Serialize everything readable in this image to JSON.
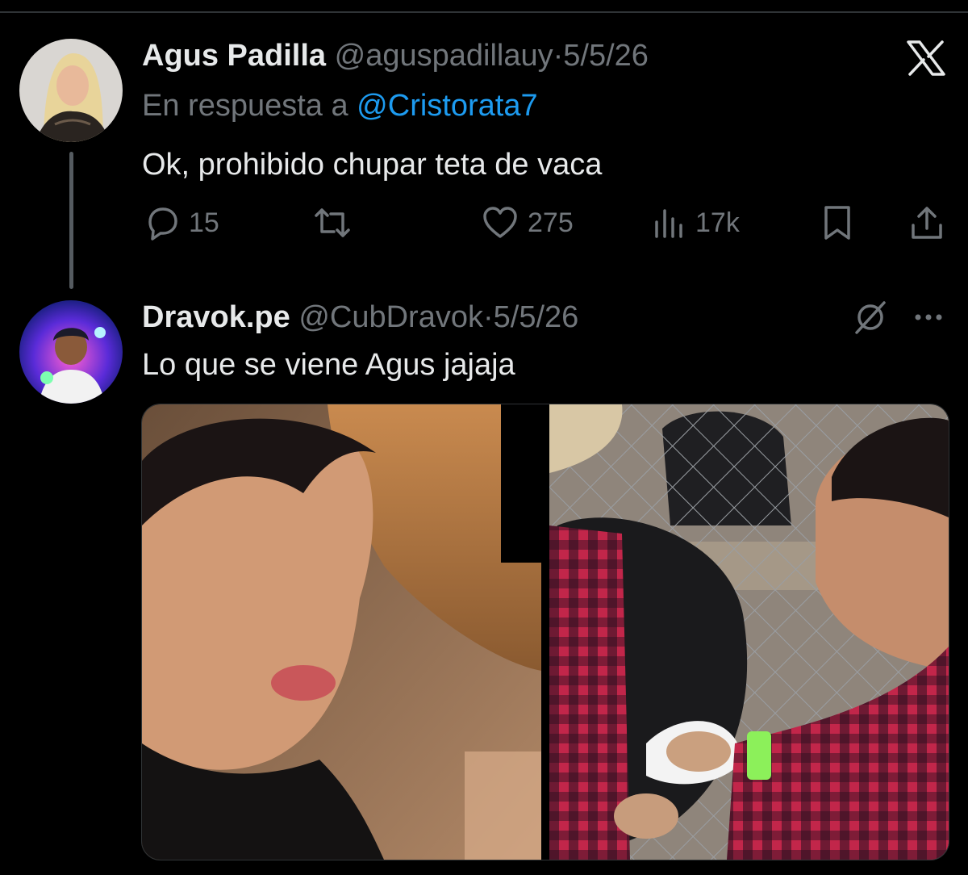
{
  "tweet1": {
    "author_name": "Agus Padilla",
    "handle": "@aguspadillauy",
    "separator": "·",
    "date": "5/5/26",
    "reply_prefix": "En respuesta a",
    "reply_mention": "@Cristorata7",
    "text": "Ok, prohibido chupar teta de vaca",
    "stats": {
      "replies": "15",
      "likes": "275",
      "views": "17k"
    },
    "icons": [
      "reply-icon",
      "retweet-icon",
      "like-icon",
      "views-icon",
      "bookmark-icon",
      "share-icon"
    ]
  },
  "tweet2": {
    "author_name": "Dravok.pe",
    "handle": "@CubDravok",
    "separator": "·",
    "date": "5/5/26",
    "text": "Lo que se viene Agus jajaja",
    "icons": [
      "grok-icon",
      "more-icon"
    ]
  },
  "brand": {
    "icon": "x-logo-icon"
  },
  "colors": {
    "background": "#000000",
    "text": "#e7e9ea",
    "muted": "#71767b",
    "link": "#1d9bf0",
    "divider": "#2f3336"
  }
}
